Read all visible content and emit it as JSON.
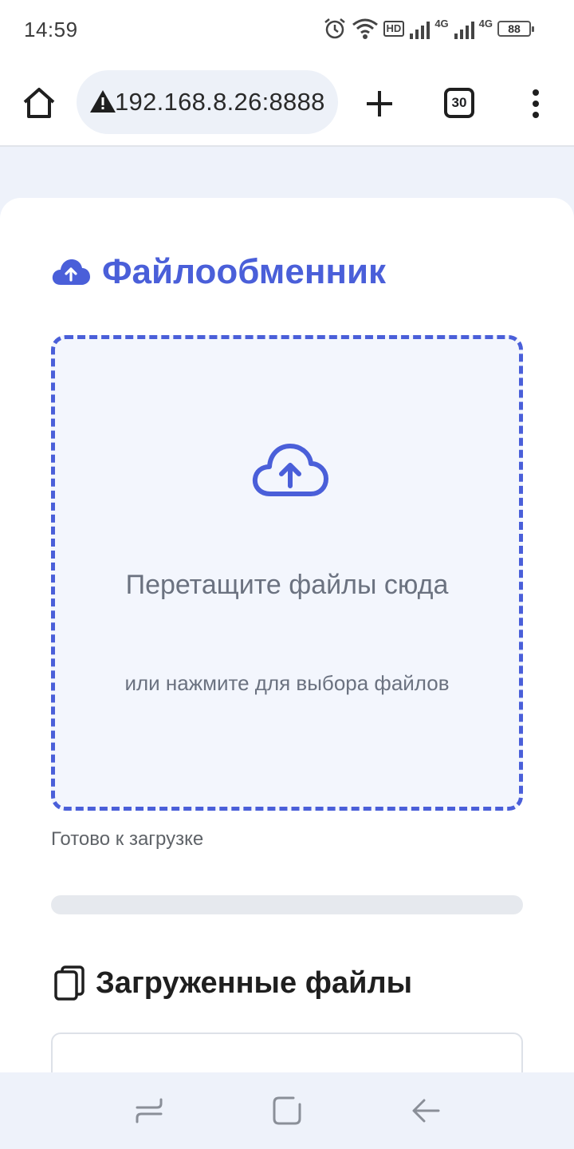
{
  "status_bar": {
    "time": "14:59",
    "icons": [
      "alarm-icon",
      "wifi-icon",
      "hd-icon",
      "signal-4g-icon",
      "signal-4g-icon",
      "battery-icon"
    ],
    "hd_label": "HD",
    "network_label_1": "4G",
    "network_label_2": "4G",
    "battery_level": "88"
  },
  "browser": {
    "url": "192.168.8.26:8888",
    "tab_count": "30",
    "icons": [
      "home-icon",
      "warning-icon",
      "plus-icon",
      "tabs-icon",
      "menu-icon"
    ]
  },
  "page": {
    "title": "Файлообменник",
    "dropzone": {
      "main_text": "Перетащите файлы сюда",
      "sub_text": "или нажмите для выбора файлов"
    },
    "upload_status": "Готово к загрузке",
    "progress": 0,
    "files_section_title": "Загруженные файлы"
  },
  "colors": {
    "accent": "#4a5fd9",
    "dropzone_bg": "#f3f6fd",
    "muted_text": "#6b7280"
  },
  "navbar": {
    "icons": [
      "recents-icon",
      "home-square-icon",
      "back-icon"
    ]
  }
}
